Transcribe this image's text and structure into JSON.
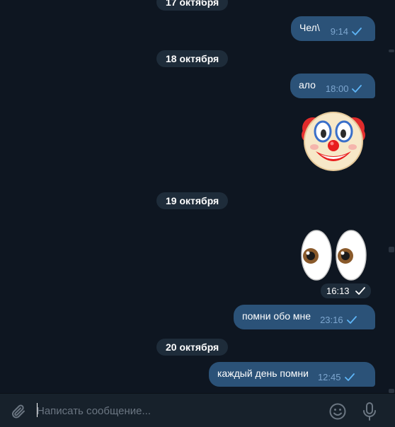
{
  "dates": {
    "d17": "17 октября",
    "d18": "18 октября",
    "d19": "19 октября",
    "d20": "20 октября"
  },
  "messages": {
    "m1": {
      "text": "Чел\\",
      "time": "9:14"
    },
    "m2": {
      "text": "ало",
      "time": "18:00"
    },
    "m3": {
      "sticker": "clown-face-icon"
    },
    "m4": {
      "sticker": "eyes-icon",
      "time": "16:13"
    },
    "m5": {
      "text": "помни обо мне",
      "time": "23:16"
    },
    "m6": {
      "text": "каждый день помни",
      "time": "12:45"
    }
  },
  "composer": {
    "placeholder": "Написать сообщение..."
  },
  "colors": {
    "background": "#0e1621",
    "bubble_out": "#2b5278",
    "date_pill": "#1e2c3a",
    "composer": "#17212b",
    "accent": "#5eb5f7"
  }
}
